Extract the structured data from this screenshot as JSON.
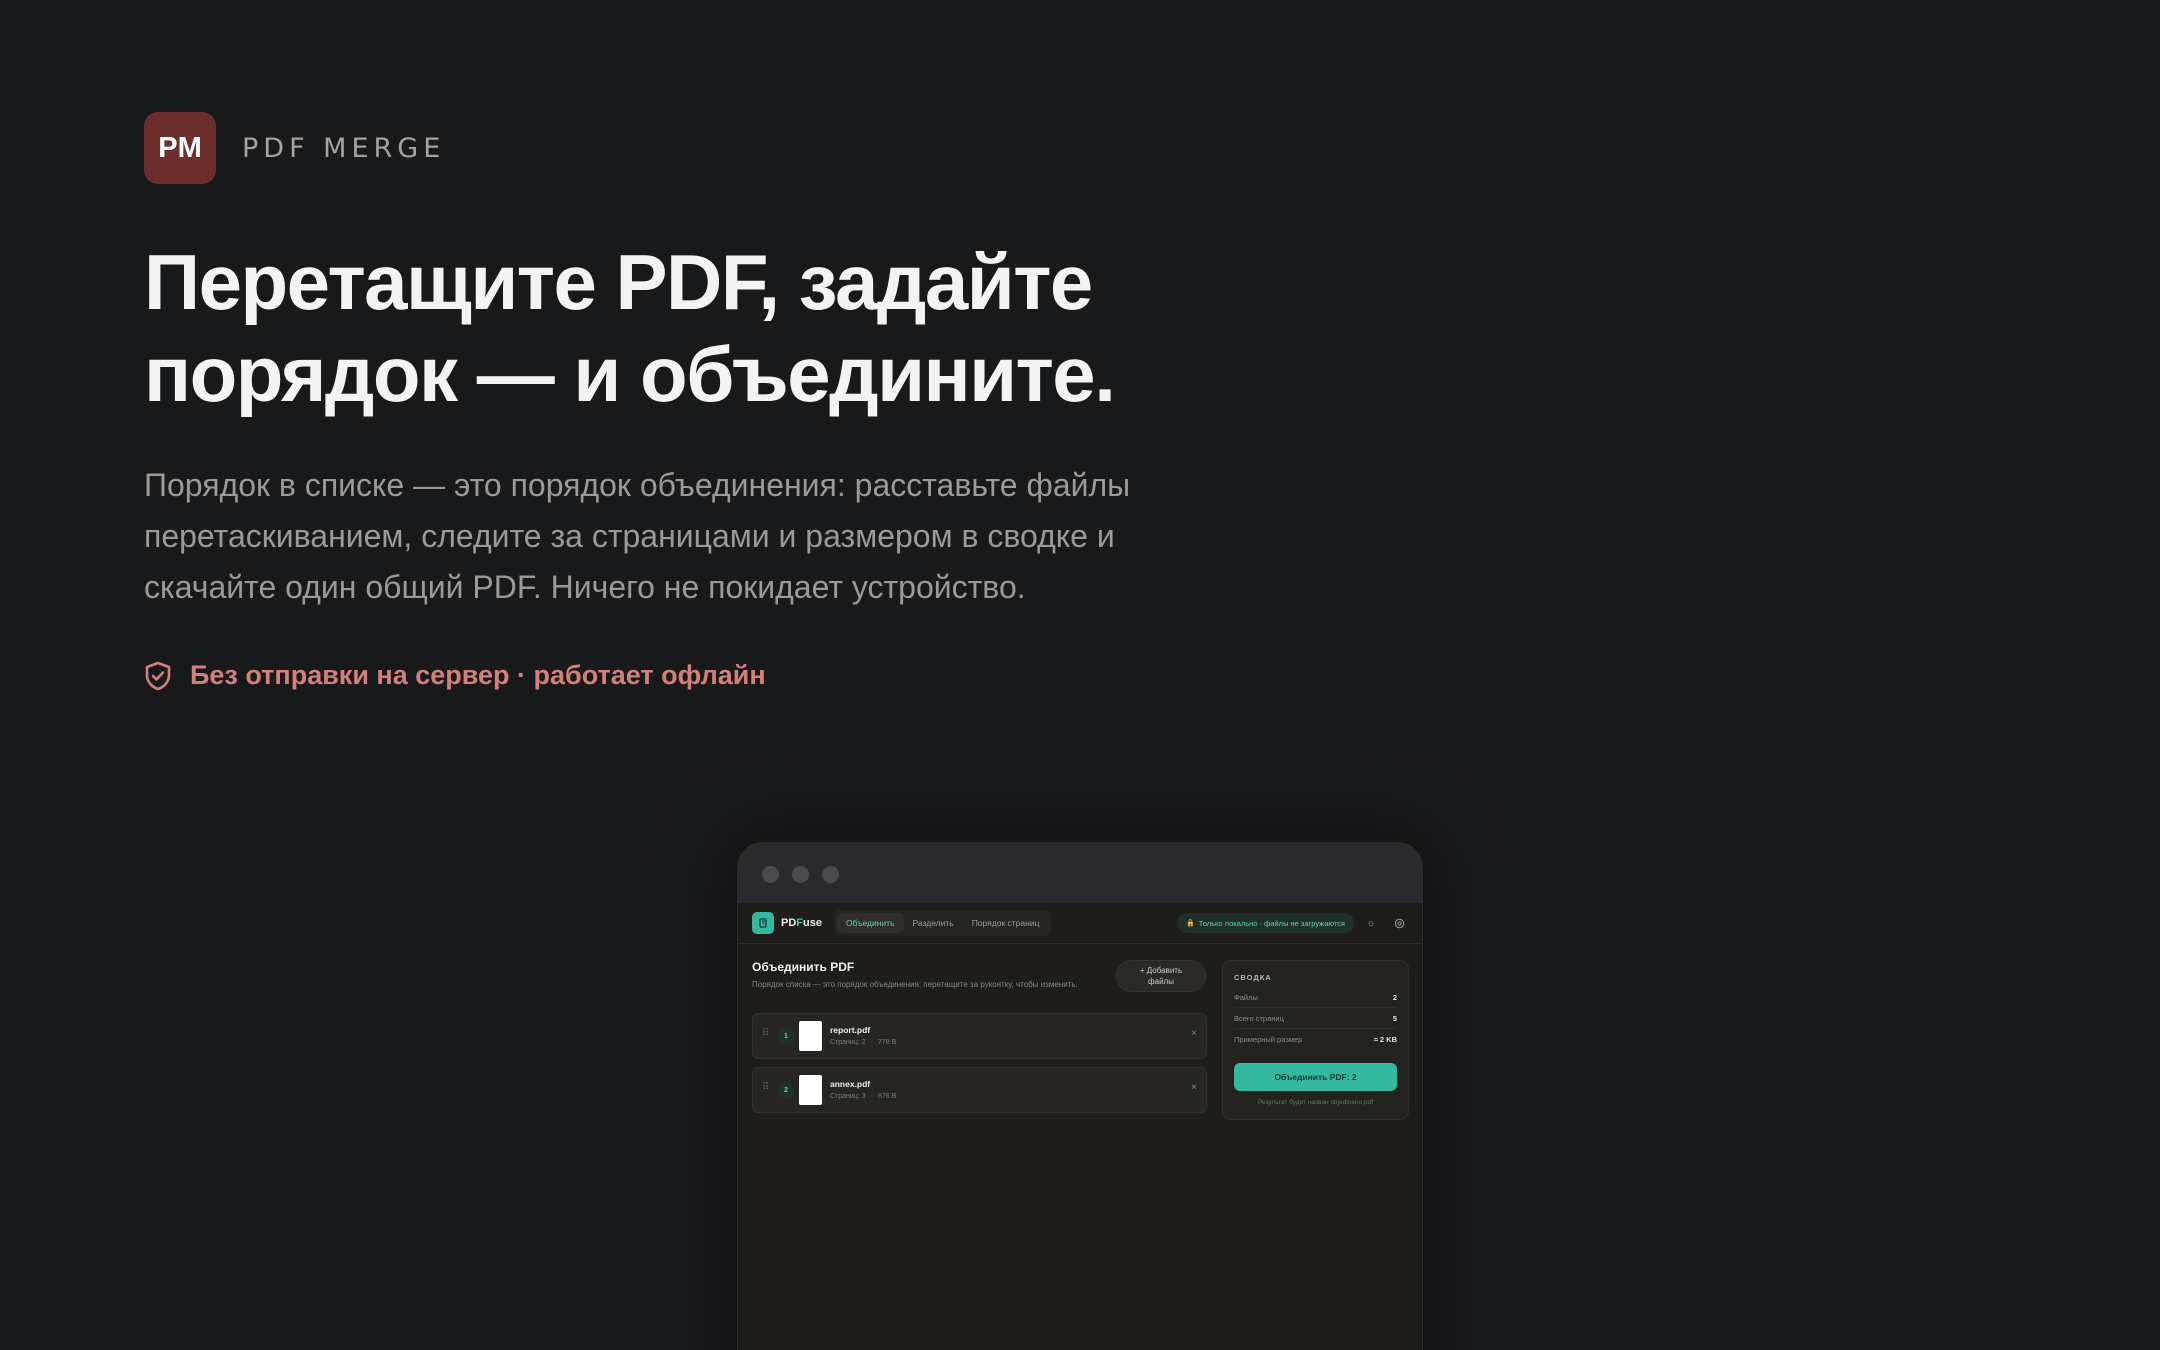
{
  "brand": {
    "logo_text": "PM",
    "name": "PDF MERGE",
    "logo_color": "#6d2e2e"
  },
  "hero": {
    "headline_line1": "Перетащите PDF, задайте",
    "headline_line2": "порядок — и объедините.",
    "lead_line1": "Порядок в списке — это порядок объединения: расставьте файлы",
    "lead_line2": "перетаскиванием, следите за страницами и размером в сводке и",
    "lead_line3": "скачайте один общий PDF. Ничего не покидает устройство.",
    "offline_note": "Без отправки на сервер · работает офлайн",
    "offline_icon": "shield-check-icon",
    "accent_color": "#d4807a"
  },
  "app": {
    "name_prefix": "PD",
    "name_accent": "F",
    "name_suffix": "use",
    "accent_color": "#35b99e",
    "tabs": [
      {
        "label": "Объединить",
        "active": true
      },
      {
        "label": "Разделить",
        "active": false
      },
      {
        "label": "Порядок страниц",
        "active": false
      }
    ],
    "local_badge": "Только локально · файлы не загружаются",
    "theme_icon": "sun-icon",
    "settings_icon": "gear-icon"
  },
  "merge": {
    "title": "Объединить PDF",
    "subtitle": "Порядок списка — это порядок объединения; перетащите за рукоятку, чтобы изменить.",
    "add_files_line1": "+ Добавить",
    "add_files_line2": "файлы",
    "files": [
      {
        "index": "1",
        "name": "report.pdf",
        "pages": "Страниц: 2",
        "size": "778 B"
      },
      {
        "index": "2",
        "name": "annex.pdf",
        "pages": "Страниц: 3",
        "size": "876 B"
      }
    ],
    "remove_icon": "close-icon"
  },
  "summary": {
    "title": "СВОДКА",
    "files_label": "Файлы",
    "files_value": "2",
    "pages_label": "Всего страниц",
    "pages_value": "5",
    "size_label": "Примерный размер",
    "size_value": "≈ 2 KB",
    "merge_button": "Объединить PDF: 2",
    "result_note": "Результат будет назван objedineno.pdf"
  }
}
